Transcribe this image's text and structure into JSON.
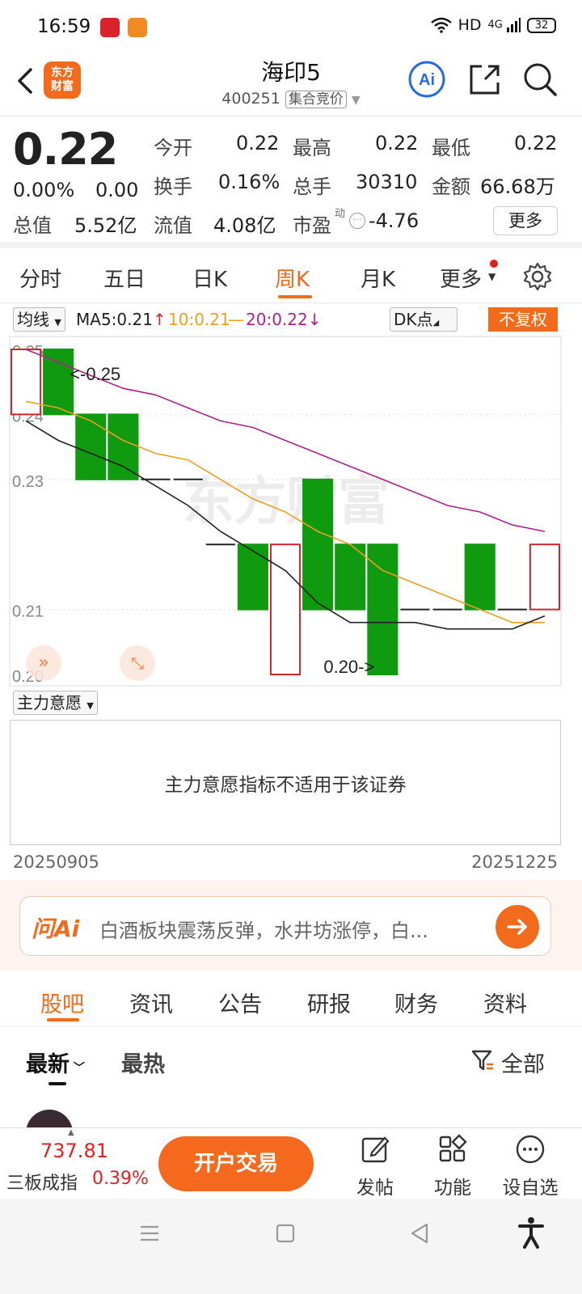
{
  "status_bar": {
    "time": "16:59",
    "network": "HD",
    "signal": "4G",
    "battery": "32"
  },
  "header": {
    "brand": "东方财富",
    "stock_name": "海印5",
    "stock_code": "400251",
    "auction_tag": "集合竞价"
  },
  "quote": {
    "price": "0.22",
    "change_pct": "0.00%",
    "change": "0.00",
    "open_label": "今开",
    "open": "0.22",
    "high_label": "最高",
    "high": "0.22",
    "low_label": "最低",
    "low": "0.22",
    "turnover_label": "换手",
    "turnover": "0.16%",
    "volume_label": "总手",
    "volume": "30310",
    "amount_label": "金额",
    "amount": "66.68万",
    "mcap_label": "总值",
    "mcap": "5.52亿",
    "float_label": "流值",
    "float_val": "4.08亿",
    "pe_label": "市盈",
    "pe_sup": "动",
    "pe": "-4.76",
    "more_label": "更多"
  },
  "tabs": [
    "分时",
    "五日",
    "日K",
    "周K",
    "月K",
    "更多"
  ],
  "active_tab": "周K",
  "ma_row": {
    "selector": "均线",
    "ma5": "MA5:0.21",
    "ma10": "10:0.21",
    "ma20": "20:0.22",
    "dk": "DK点",
    "fuquan": "不复权"
  },
  "colors": {
    "accent": "#f26a1b",
    "up": "#c8282d",
    "down": "#109a10",
    "ma5": "#222222",
    "ma10": "#e8a020",
    "ma20": "#b0208a"
  },
  "chart_data": {
    "type": "candlestick",
    "period": "weekly",
    "y_ticks": [
      "0.25",
      "0.24",
      "0.23",
      "0.21",
      "0.20"
    ],
    "ylim": [
      0.2,
      0.25
    ],
    "candles": [
      {
        "o": 0.24,
        "h": 0.25,
        "l": 0.24,
        "c": 0.25
      },
      {
        "o": 0.25,
        "h": 0.25,
        "l": 0.24,
        "c": 0.24
      },
      {
        "o": 0.24,
        "h": 0.24,
        "l": 0.23,
        "c": 0.23
      },
      {
        "o": 0.24,
        "h": 0.24,
        "l": 0.23,
        "c": 0.23
      },
      {
        "o": 0.23,
        "h": 0.23,
        "l": 0.23,
        "c": 0.23
      },
      {
        "o": 0.23,
        "h": 0.23,
        "l": 0.23,
        "c": 0.23
      },
      {
        "o": 0.22,
        "h": 0.22,
        "l": 0.22,
        "c": 0.22
      },
      {
        "o": 0.22,
        "h": 0.22,
        "l": 0.21,
        "c": 0.21
      },
      {
        "o": 0.2,
        "h": 0.22,
        "l": 0.2,
        "c": 0.22
      },
      {
        "o": 0.23,
        "h": 0.23,
        "l": 0.21,
        "c": 0.21
      },
      {
        "o": 0.22,
        "h": 0.22,
        "l": 0.21,
        "c": 0.21
      },
      {
        "o": 0.22,
        "h": 0.22,
        "l": 0.2,
        "c": 0.2
      },
      {
        "o": 0.21,
        "h": 0.21,
        "l": 0.21,
        "c": 0.21
      },
      {
        "o": 0.21,
        "h": 0.21,
        "l": 0.21,
        "c": 0.21
      },
      {
        "o": 0.22,
        "h": 0.22,
        "l": 0.21,
        "c": 0.21
      },
      {
        "o": 0.21,
        "h": 0.21,
        "l": 0.21,
        "c": 0.21
      },
      {
        "o": 0.21,
        "h": 0.22,
        "l": 0.21,
        "c": 0.22
      }
    ],
    "ma5": [
      0.239,
      0.236,
      0.234,
      0.232,
      0.229,
      0.226,
      0.222,
      0.219,
      0.216,
      0.211,
      0.208,
      0.208,
      0.208,
      0.207,
      0.207,
      0.207,
      0.209
    ],
    "ma10": [
      0.242,
      0.241,
      0.239,
      0.236,
      0.234,
      0.233,
      0.23,
      0.227,
      0.225,
      0.222,
      0.22,
      0.216,
      0.214,
      0.212,
      0.21,
      0.208,
      0.208
    ],
    "ma20": [
      0.25,
      0.248,
      0.246,
      0.244,
      0.243,
      0.241,
      0.239,
      0.238,
      0.236,
      0.234,
      0.232,
      0.23,
      0.228,
      0.226,
      0.225,
      0.223,
      0.222
    ],
    "max_label": "0.25",
    "min_label": "0.20",
    "watermark": "东方财富"
  },
  "indicator": {
    "selector": "主力意愿",
    "message": "主力意愿指标不适用于该证券"
  },
  "dates": {
    "start": "20250905",
    "end": "20251225"
  },
  "ai_bar": {
    "logo": "问Ai",
    "text": "白酒板块震荡反弹，水井坊涨停，白..."
  },
  "sub_tabs": [
    "股吧",
    "资讯",
    "公告",
    "研报",
    "财务",
    "资料"
  ],
  "filters": {
    "latest": "最新",
    "hot": "最热",
    "all": "全部"
  },
  "bottom_bar": {
    "index_value": "737.81",
    "index_name": "三板成指",
    "index_pct": "0.39%",
    "trade": "开户交易",
    "post": "发帖",
    "function": "功能",
    "watch": "设自选"
  }
}
